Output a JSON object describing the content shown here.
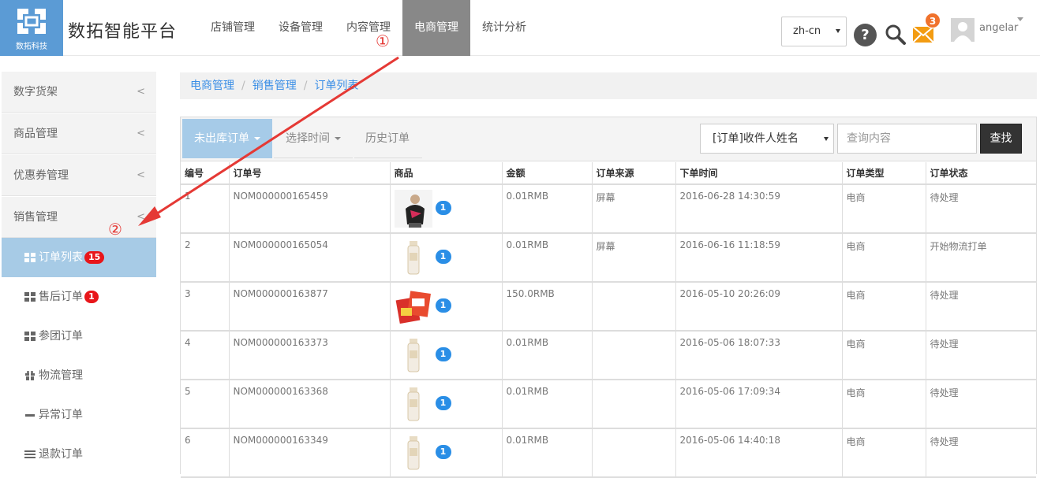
{
  "brand": {
    "title": "数拓智能平台",
    "sub": "数拓科技",
    "color": "#5b9bd5"
  },
  "nav": {
    "items": [
      "店铺管理",
      "设备管理",
      "内容管理",
      "电商管理",
      "统计分析"
    ],
    "active": "电商管理"
  },
  "header": {
    "lang": "zh-cn",
    "mail_count": "3",
    "user": "angelar"
  },
  "sidebar": {
    "groups": [
      "数字货架",
      "商品管理",
      "优惠券管理",
      "销售管理"
    ],
    "subs": [
      {
        "label": "订单列表",
        "badge": "15"
      },
      {
        "label": "售后订单",
        "badge": "1"
      },
      {
        "label": "参团订单",
        "badge": ""
      },
      {
        "label": "物流管理",
        "badge": ""
      },
      {
        "label": "异常订单",
        "badge": ""
      },
      {
        "label": "退款订单",
        "badge": ""
      }
    ]
  },
  "breadcrumb": [
    "电商管理",
    "销售管理",
    "订单列表"
  ],
  "toolbar": {
    "tab_unshipped": "未出库订单",
    "tab_time": "选择时间",
    "tab_history": "历史订单",
    "field": "[订单]收件人姓名",
    "placeholder": "查询内容",
    "search": "查找"
  },
  "table": {
    "headers": [
      "编号",
      "订单号",
      "商品",
      "金额",
      "订单来源",
      "下单时间",
      "订单类型",
      "订单状态"
    ],
    "rows": [
      {
        "no": "1",
        "order": "NOM000000165459",
        "qty": "1",
        "amount": "0.01RMB",
        "source": "屏幕",
        "time": "2016-06-28 14:30:59",
        "type": "电商",
        "status": "待处理"
      },
      {
        "no": "2",
        "order": "NOM000000165054",
        "qty": "1",
        "amount": "0.01RMB",
        "source": "屏幕",
        "time": "2016-06-16 11:18:59",
        "type": "电商",
        "status": "开始物流打单"
      },
      {
        "no": "3",
        "order": "NOM000000163877",
        "qty": "1",
        "amount": "150.0RMB",
        "source": "",
        "time": "2016-05-10 20:26:09",
        "type": "电商",
        "status": "待处理"
      },
      {
        "no": "4",
        "order": "NOM000000163373",
        "qty": "1",
        "amount": "0.01RMB",
        "source": "",
        "time": "2016-05-06 18:07:33",
        "type": "电商",
        "status": "待处理"
      },
      {
        "no": "5",
        "order": "NOM000000163368",
        "qty": "1",
        "amount": "0.01RMB",
        "source": "",
        "time": "2016-05-06 17:09:34",
        "type": "电商",
        "status": "待处理"
      },
      {
        "no": "6",
        "order": "NOM000000163349",
        "qty": "1",
        "amount": "0.01RMB",
        "source": "",
        "time": "2016-05-06 14:40:18",
        "type": "电商",
        "status": "待处理"
      }
    ]
  },
  "annotations": {
    "one": "①",
    "two": "②",
    "color": "#e53935"
  }
}
